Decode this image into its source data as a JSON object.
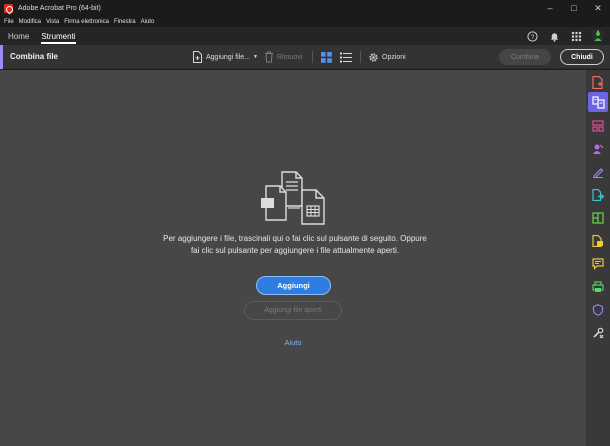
{
  "window": {
    "title": "Adobe Acrobat Pro (64-bit)",
    "controls": {
      "minimize": "–",
      "maximize": "□",
      "close": "✕"
    }
  },
  "menubar": {
    "items": [
      "File",
      "Modifica",
      "Vista",
      "Firma elettronica",
      "Finestra",
      "Aiuto"
    ]
  },
  "tabs": {
    "home": "Home",
    "strumenti": "Strumenti",
    "active": "Strumenti",
    "right_icons": [
      "help-icon",
      "bell-icon",
      "apps-grid-icon",
      "user-avatar-icon"
    ]
  },
  "toolbar": {
    "title": "Combina file",
    "add_files": "Aggiungi file...",
    "remove": "Rimuovi",
    "options": "Opzioni",
    "combine": "Combina",
    "close": "Chiudi",
    "view_modes": [
      "thumbnail-view-icon",
      "list-view-icon"
    ]
  },
  "main": {
    "message": "Per aggiungere i file, trascinali qui o fai clic sul pulsante di seguito. Oppure fai clic sul pulsante per aggiungere i file attualmente aperti.",
    "add_button": "Aggiungi",
    "add_open_button": "Aggiungi file aperti",
    "help_link": "Aiuto"
  },
  "right_rail": {
    "icons": [
      "create-pdf-icon",
      "combine-files-icon",
      "organize-pages-icon",
      "request-signature-icon",
      "fill-sign-icon",
      "export-pdf-icon",
      "edit-pdf-icon",
      "compress-pdf-icon",
      "comment-icon",
      "print-production-icon",
      "protect-icon",
      "more-tools-icon"
    ]
  },
  "colors": {
    "accent_purple": "#9a8df5",
    "rail_active": "#6e64e3",
    "primary_blue": "#2d7de3",
    "link_blue": "#7ab4f5",
    "workspace_bg": "#474747"
  }
}
